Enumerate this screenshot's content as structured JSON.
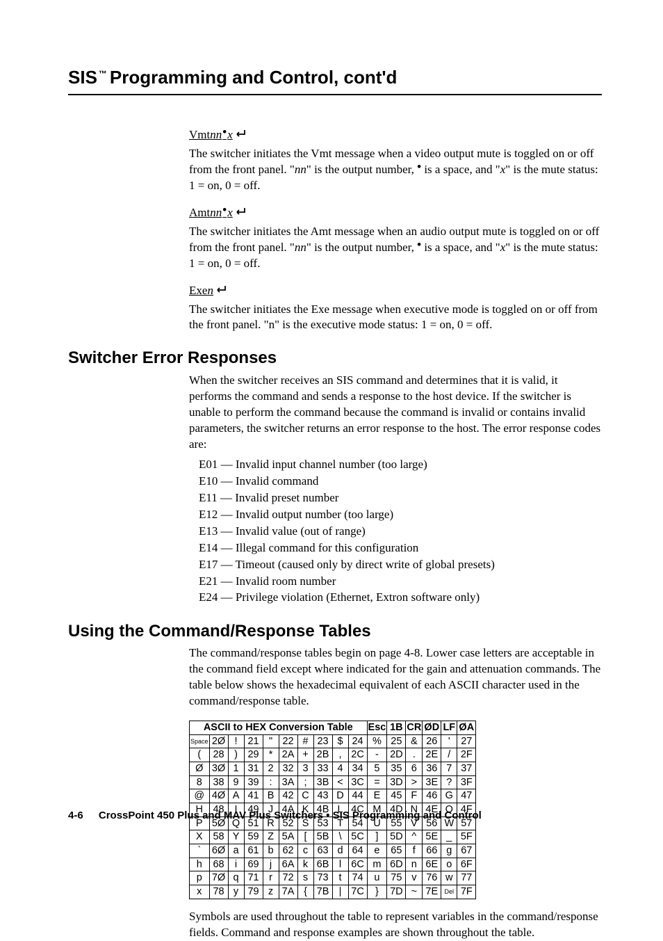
{
  "running_head": {
    "sis": "SIS",
    "tm": "™",
    "rest": " Programming and Control, cont'd"
  },
  "sections": {
    "vmt": {
      "label_parts": {
        "pre": "Vmt",
        "n": "nn",
        "bullet": "•",
        "x": "x"
      },
      "para": "The switcher initiates the Vmt message when a video output mute is toggled on or off from the front panel.  \"nn\" is the output number, • is a space, and \"x\" is the mute status: 1 = on, 0 = off."
    },
    "amt": {
      "label_parts": {
        "pre": "Amt",
        "n": "nn",
        "bullet": "•",
        "x": "x"
      },
      "para": "The switcher initiates the Amt message when an audio output mute is toggled on or off from the front panel.  \"nn\" is the output number, • is a space, and \"x\" is the mute status: 1 = on, 0 = off."
    },
    "exe": {
      "label_parts": {
        "pre": "Exe",
        "n": "n"
      },
      "para": "The switcher initiates the Exe message when executive mode is toggled on or off from the front panel.  \"n\" is the executive mode status: 1 = on, 0 = off."
    }
  },
  "switcher_heading": "Switcher Error Responses",
  "switcher_intro": "When the switcher receives an SIS command and determines that it is valid, it performs the command and sends a response to the host device.  If the switcher is unable to perform the command because the command is invalid or contains invalid parameters, the switcher returns an error response to the host.  The error response codes are:",
  "error_codes": [
    "E01 — Invalid input channel number (too large)",
    "E10 — Invalid command",
    "E11 — Invalid preset number",
    "E12 — Invalid output number (too large)",
    "E13 — Invalid value (out of range)",
    "E14 — Illegal command for this configuration",
    "E17 — Timeout (caused only by direct write of global presets)",
    "E21 — Invalid room number",
    "E24 — Privilege violation (Ethernet, Extron software only)"
  ],
  "using_heading": "Using the Command/Response Tables",
  "using_para": "The command/response tables begin on page 4-8.  Lower case letters are acceptable in the command field except where indicated for the gain and attenuation commands.  The table below shows the hexadecimal equivalent of each ASCII character used in the command/response table.",
  "ascii_title": "ASCII to HEX  Conversion Table",
  "ascii_special": [
    [
      "Esc",
      "1B"
    ],
    [
      "CR",
      "ØD"
    ],
    [
      "LF",
      "ØA"
    ]
  ],
  "ascii_rows": [
    [
      [
        "Space",
        "2Ø"
      ],
      [
        "!",
        "21"
      ],
      [
        "\"",
        "22"
      ],
      [
        "#",
        "23"
      ],
      [
        "$",
        "24"
      ],
      [
        "%",
        "25"
      ],
      [
        "&",
        "26"
      ],
      [
        "'",
        "27"
      ]
    ],
    [
      [
        "(",
        "28"
      ],
      [
        ")",
        "29"
      ],
      [
        "*",
        "2A"
      ],
      [
        "+",
        "2B"
      ],
      [
        ",",
        "2C"
      ],
      [
        "-",
        "2D"
      ],
      [
        ".",
        "2E"
      ],
      [
        "/",
        "2F"
      ]
    ],
    [
      [
        "Ø",
        "3Ø"
      ],
      [
        "1",
        "31"
      ],
      [
        "2",
        "32"
      ],
      [
        "3",
        "33"
      ],
      [
        "4",
        "34"
      ],
      [
        "5",
        "35"
      ],
      [
        "6",
        "36"
      ],
      [
        "7",
        "37"
      ]
    ],
    [
      [
        "8",
        "38"
      ],
      [
        "9",
        "39"
      ],
      [
        ":",
        "3A"
      ],
      [
        ";",
        "3B"
      ],
      [
        "<",
        "3C"
      ],
      [
        "=",
        "3D"
      ],
      [
        ">",
        "3E"
      ],
      [
        "?",
        "3F"
      ]
    ],
    [
      [
        "@",
        "4Ø"
      ],
      [
        "A",
        "41"
      ],
      [
        "B",
        "42"
      ],
      [
        "C",
        "43"
      ],
      [
        "D",
        "44"
      ],
      [
        "E",
        "45"
      ],
      [
        "F",
        "46"
      ],
      [
        "G",
        "47"
      ]
    ],
    [
      [
        "H",
        "48"
      ],
      [
        "I",
        "49"
      ],
      [
        "J",
        "4A"
      ],
      [
        "K",
        "4B"
      ],
      [
        "L",
        "4C"
      ],
      [
        "M",
        "4D"
      ],
      [
        "N",
        "4E"
      ],
      [
        "O",
        "4F"
      ]
    ],
    [
      [
        "P",
        "5Ø"
      ],
      [
        "Q",
        "51"
      ],
      [
        "R",
        "52"
      ],
      [
        "S",
        "53"
      ],
      [
        "T",
        "54"
      ],
      [
        "U",
        "55"
      ],
      [
        "V",
        "56"
      ],
      [
        "W",
        "57"
      ]
    ],
    [
      [
        "X",
        "58"
      ],
      [
        "Y",
        "59"
      ],
      [
        "Z",
        "5A"
      ],
      [
        "[",
        "5B"
      ],
      [
        "\\",
        "5C"
      ],
      [
        "]",
        "5D"
      ],
      [
        "^",
        "5E"
      ],
      [
        "_",
        "5F"
      ]
    ],
    [
      [
        "`",
        "6Ø"
      ],
      [
        "a",
        "61"
      ],
      [
        "b",
        "62"
      ],
      [
        "c",
        "63"
      ],
      [
        "d",
        "64"
      ],
      [
        "e",
        "65"
      ],
      [
        "f",
        "66"
      ],
      [
        "g",
        "67"
      ]
    ],
    [
      [
        "h",
        "68"
      ],
      [
        "i",
        "69"
      ],
      [
        "j",
        "6A"
      ],
      [
        "k",
        "6B"
      ],
      [
        "l",
        "6C"
      ],
      [
        "m",
        "6D"
      ],
      [
        "n",
        "6E"
      ],
      [
        "o",
        "6F"
      ]
    ],
    [
      [
        "p",
        "7Ø"
      ],
      [
        "q",
        "71"
      ],
      [
        "r",
        "72"
      ],
      [
        "s",
        "73"
      ],
      [
        "t",
        "74"
      ],
      [
        "u",
        "75"
      ],
      [
        "v",
        "76"
      ],
      [
        "w",
        "77"
      ]
    ],
    [
      [
        "x",
        "78"
      ],
      [
        "y",
        "79"
      ],
      [
        "z",
        "7A"
      ],
      [
        "{",
        "7B"
      ],
      [
        "|",
        "7C"
      ],
      [
        "}",
        "7D"
      ],
      [
        "~",
        "7E"
      ],
      [
        "Del",
        "7F"
      ]
    ]
  ],
  "symbols_para": "Symbols are used throughout the table to represent variables in the command/response fields.  Command and response examples are shown throughout the table.",
  "footer": {
    "page": "4-6",
    "title": "CrossPoint 450 Plus and MAV Plus Switchers • SIS Programming and Control"
  }
}
